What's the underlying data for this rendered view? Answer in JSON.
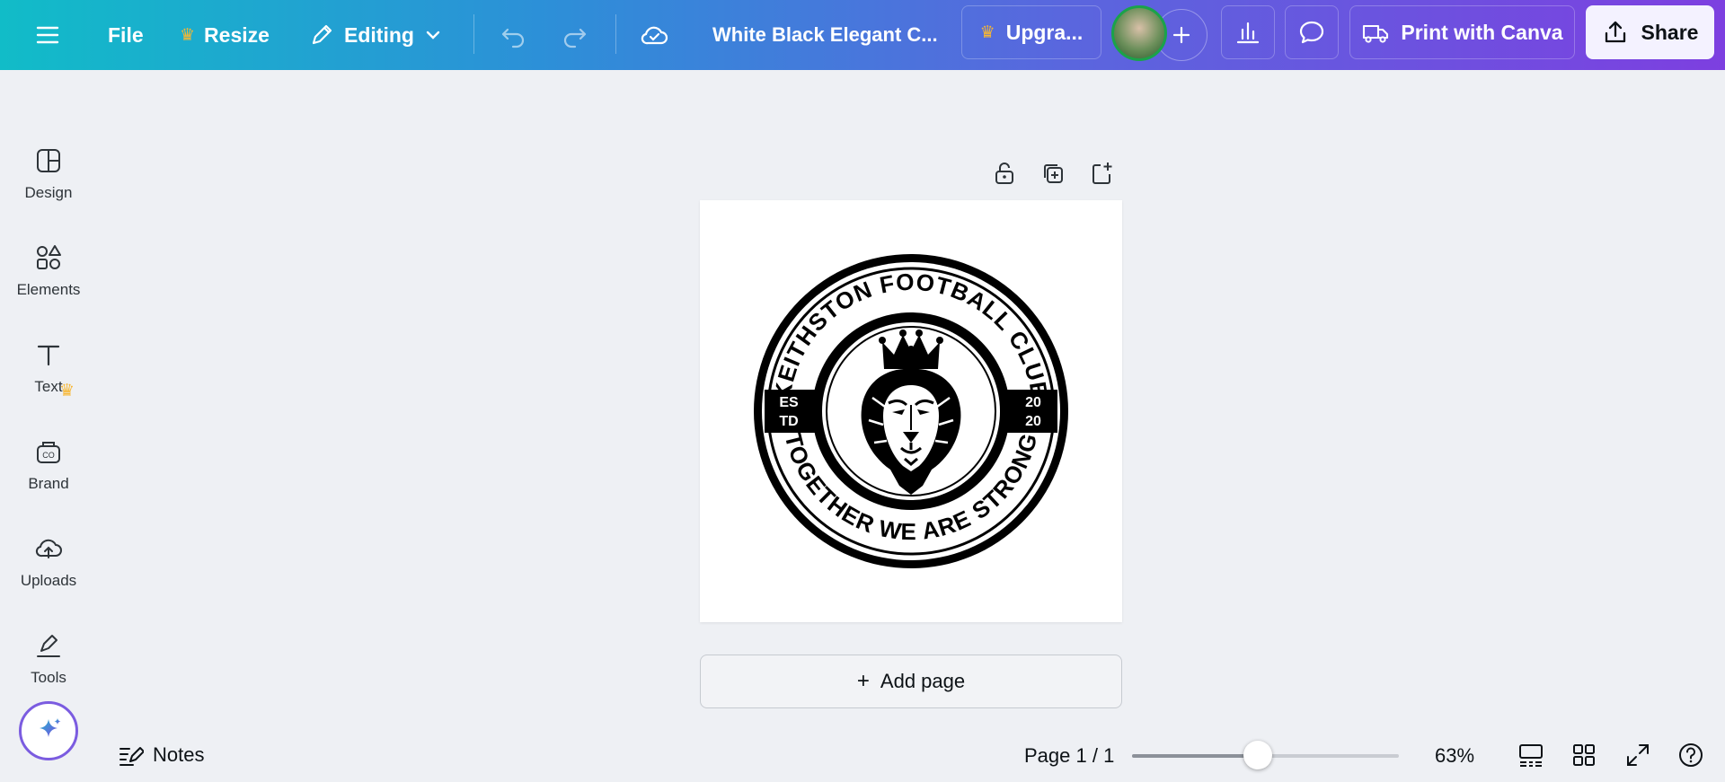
{
  "topbar": {
    "file_label": "File",
    "resize_label": "Resize",
    "editing_label": "Editing",
    "doc_title": "White Black Elegant C...",
    "upgrade_label": "Upgra...",
    "print_label": "Print with Canva",
    "share_label": "Share"
  },
  "sidebar": {
    "items": [
      {
        "label": "Design",
        "icon": "design-icon"
      },
      {
        "label": "Elements",
        "icon": "elements-icon"
      },
      {
        "label": "Text",
        "icon": "text-icon"
      },
      {
        "label": "Brand",
        "icon": "brand-icon"
      },
      {
        "label": "Uploads",
        "icon": "uploads-icon"
      },
      {
        "label": "Tools",
        "icon": "tools-icon"
      }
    ]
  },
  "badge": {
    "top_text": "KEITHSTON FOOTBALL CLUB",
    "bottom_text": "TOGETHER WE ARE STRONG",
    "left_top": "ES",
    "left_bottom": "TD",
    "right_top": "20",
    "right_bottom": "20"
  },
  "canvas": {
    "add_page_label": "Add page"
  },
  "bottombar": {
    "notes_label": "Notes",
    "page_indicator": "Page 1 / 1",
    "zoom_label": "63%",
    "zoom_fraction": 0.47
  },
  "colors": {
    "crown": "#f7b733",
    "accent": "#7d3fe0",
    "badge": "#000000"
  }
}
